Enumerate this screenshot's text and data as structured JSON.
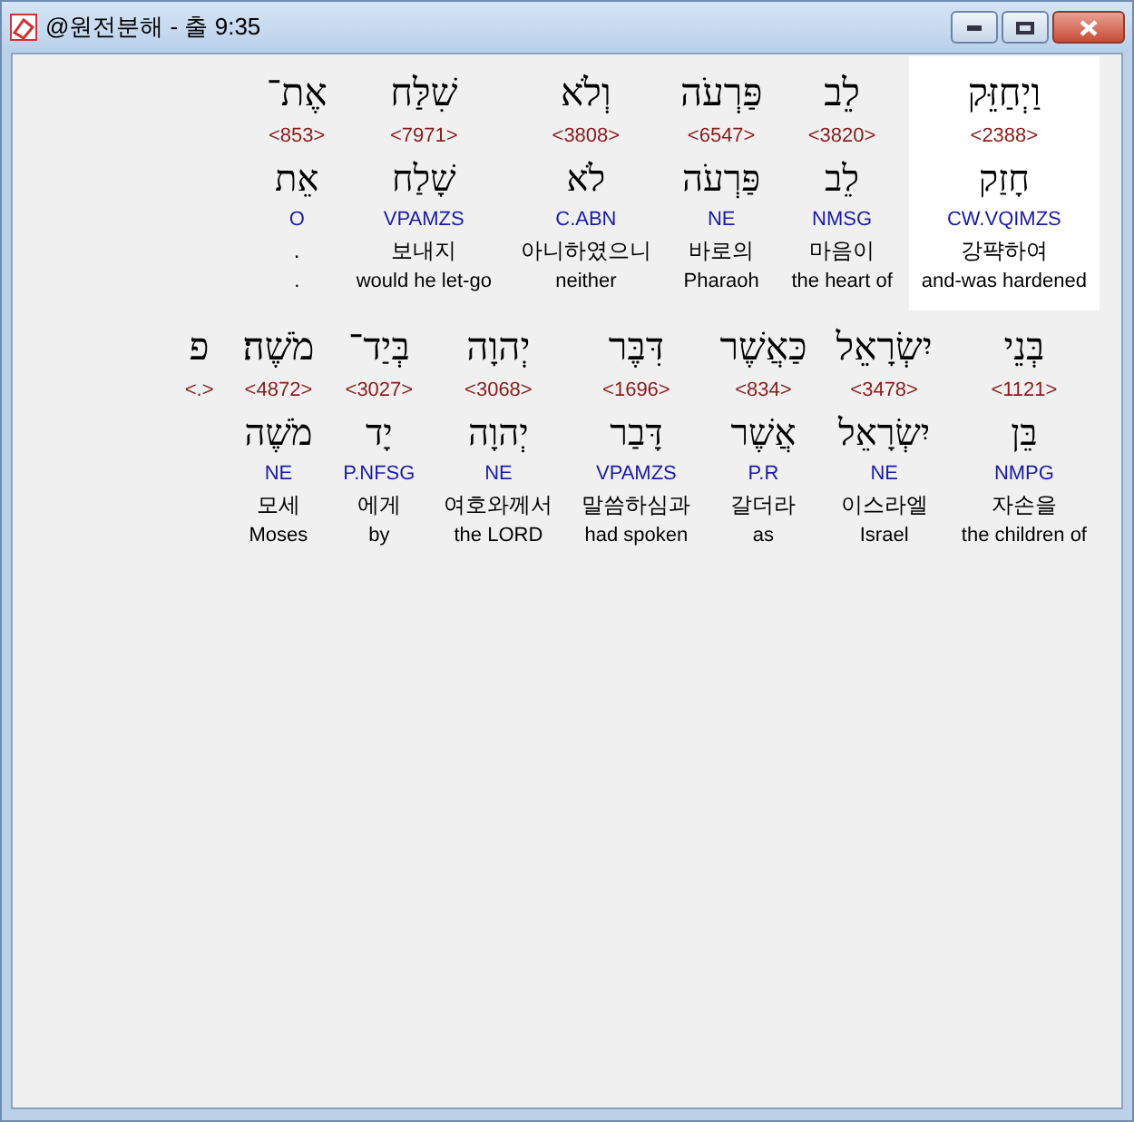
{
  "window": {
    "title": "@원전분해 - 출 9:35"
  },
  "lines": [
    {
      "words": [
        {
          "hebrew": "וַיְחַזֵּק",
          "strong": "<2388>",
          "lemma": "חָזַק",
          "morph": "CW.VQIMZS",
          "korean": "강퍅하여",
          "english": "and-was hardened",
          "selected": true
        },
        {
          "hebrew": "לֵב",
          "strong": "<3820>",
          "lemma": "לֵב",
          "morph": "NMSG",
          "korean": "마음이",
          "english": "the heart of",
          "selected": false
        },
        {
          "hebrew": "פַּרְעֹה",
          "strong": "<6547>",
          "lemma": "פַּרְעֹה",
          "morph": "NE",
          "korean": "바로의",
          "english": "Pharaoh",
          "selected": false
        },
        {
          "hebrew": "וְלֹא",
          "strong": "<3808>",
          "lemma": "לֹא",
          "morph": "C.ABN",
          "korean": "아니하였으니",
          "english": "neither",
          "selected": false
        },
        {
          "hebrew": "שִׁלַּח",
          "strong": "<7971>",
          "lemma": "שָׁלַח",
          "morph": "VPAMZS",
          "korean": "보내지",
          "english": "would he let-go",
          "selected": false
        },
        {
          "hebrew": "אֶת־",
          "strong": "<853>",
          "lemma": "אֵת",
          "morph": "O",
          "korean": ".",
          "english": ".",
          "selected": false
        }
      ]
    },
    {
      "words": [
        {
          "hebrew": "בְּנֵי",
          "strong": "<1121>",
          "lemma": "בֵּן",
          "morph": "NMPG",
          "korean": "자손을",
          "english": "the children of",
          "selected": false
        },
        {
          "hebrew": "יִשְׂרָאֵל",
          "strong": "<3478>",
          "lemma": "יִשְׂרָאֵל",
          "morph": "NE",
          "korean": "이스라엘",
          "english": "Israel",
          "selected": false
        },
        {
          "hebrew": "כַּאֲשֶׁר",
          "strong": "<834>",
          "lemma": "אֲשֶׁר",
          "morph": "P.R",
          "korean": "갈더라",
          "english": "as",
          "selected": false
        },
        {
          "hebrew": "דִּבֶּר",
          "strong": "<1696>",
          "lemma": "דָּבַר",
          "morph": "VPAMZS",
          "korean": "말씀하심과",
          "english": "had spoken",
          "selected": false
        },
        {
          "hebrew": "יְהוָה",
          "strong": "<3068>",
          "lemma": "יְהוָה",
          "morph": "NE",
          "korean": "여호와께서",
          "english": "the LORD",
          "selected": false
        },
        {
          "hebrew": "בְּיַד־",
          "strong": "<3027>",
          "lemma": "יָד",
          "morph": "P.NFSG",
          "korean": "에게",
          "english": "by",
          "selected": false
        },
        {
          "hebrew": "מֹשֶׁה׃",
          "strong": "<4872>",
          "lemma": "מֹשֶׁה",
          "morph": "NE",
          "korean": "모세",
          "english": "Moses",
          "selected": false
        },
        {
          "hebrew": "פ",
          "strong": "<.>",
          "selected": false
        }
      ]
    }
  ]
}
